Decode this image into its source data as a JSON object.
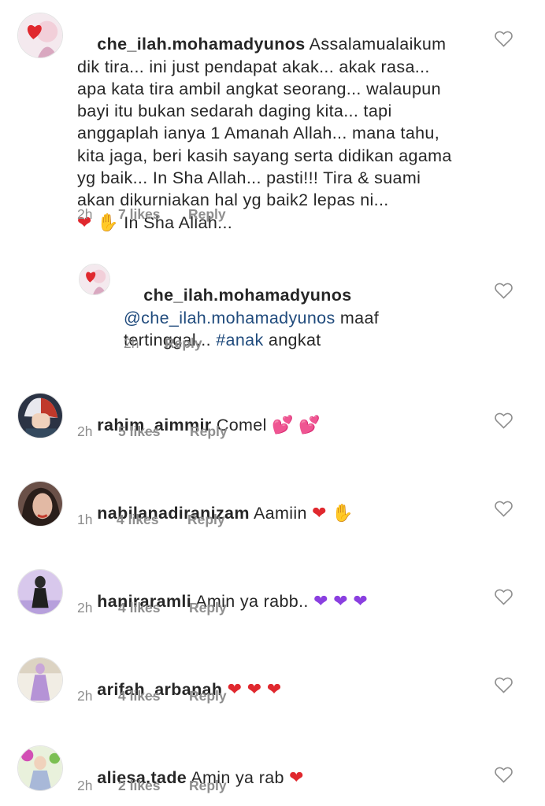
{
  "comments": [
    {
      "username": "che_ilah.mohamadyunos",
      "text": "Assalamualaikum dik tira... ini just pendapat akak... akak rasa... apa kata tira ambil angkat seorang... walaupun bayi itu bukan sedarah daging kita... tapi anggaplah ianya 1 Amanah Allah... mana tahu, kita jaga, beri kasih sayang serta didikan agama yg baik... In Sha Allah... pasti!!! Tira & suami akan dikurniakan hal yg baik2 lepas ni...",
      "text_end": "In Sha Allah...",
      "time": "2h",
      "likes": "7 likes",
      "reply": "Reply"
    },
    {
      "username": "che_ilah.mohamadyunos",
      "mention": "@che_ilah.mohamadyunos",
      "text_a": "maaf tertinggal...",
      "hashtag": "#anak",
      "text_b": "angkat",
      "time": "2h",
      "reply": "Reply"
    },
    {
      "username": "rahim_aimmir",
      "text": "Comel",
      "time": "2h",
      "likes": "5 likes",
      "reply": "Reply"
    },
    {
      "username": "nabilanadiranizam",
      "text": "Aamiin",
      "time": "1h",
      "likes": "4 likes",
      "reply": "Reply"
    },
    {
      "username": "haniraramli",
      "text": "Amin ya rabb..",
      "time": "2h",
      "likes": "4 likes",
      "reply": "Reply"
    },
    {
      "username": "arifah_arbanah",
      "text": "",
      "time": "2h",
      "likes": "4 likes",
      "reply": "Reply"
    },
    {
      "username": "aliesa.tade",
      "text": "Amin ya rab",
      "time": "2h",
      "likes": "2 likes",
      "reply": "Reply"
    }
  ],
  "icons": {
    "like": "heart-outline-icon",
    "heart": "red-heart-emoji",
    "purple_heart": "purple-heart-emoji",
    "two_hearts": "two-hearts-emoji",
    "hands": "palms-up-emoji"
  },
  "colors": {
    "text": "#262626",
    "meta": "#8e8e8e",
    "link": "#1f4a7c",
    "heart": "#e0282e"
  }
}
